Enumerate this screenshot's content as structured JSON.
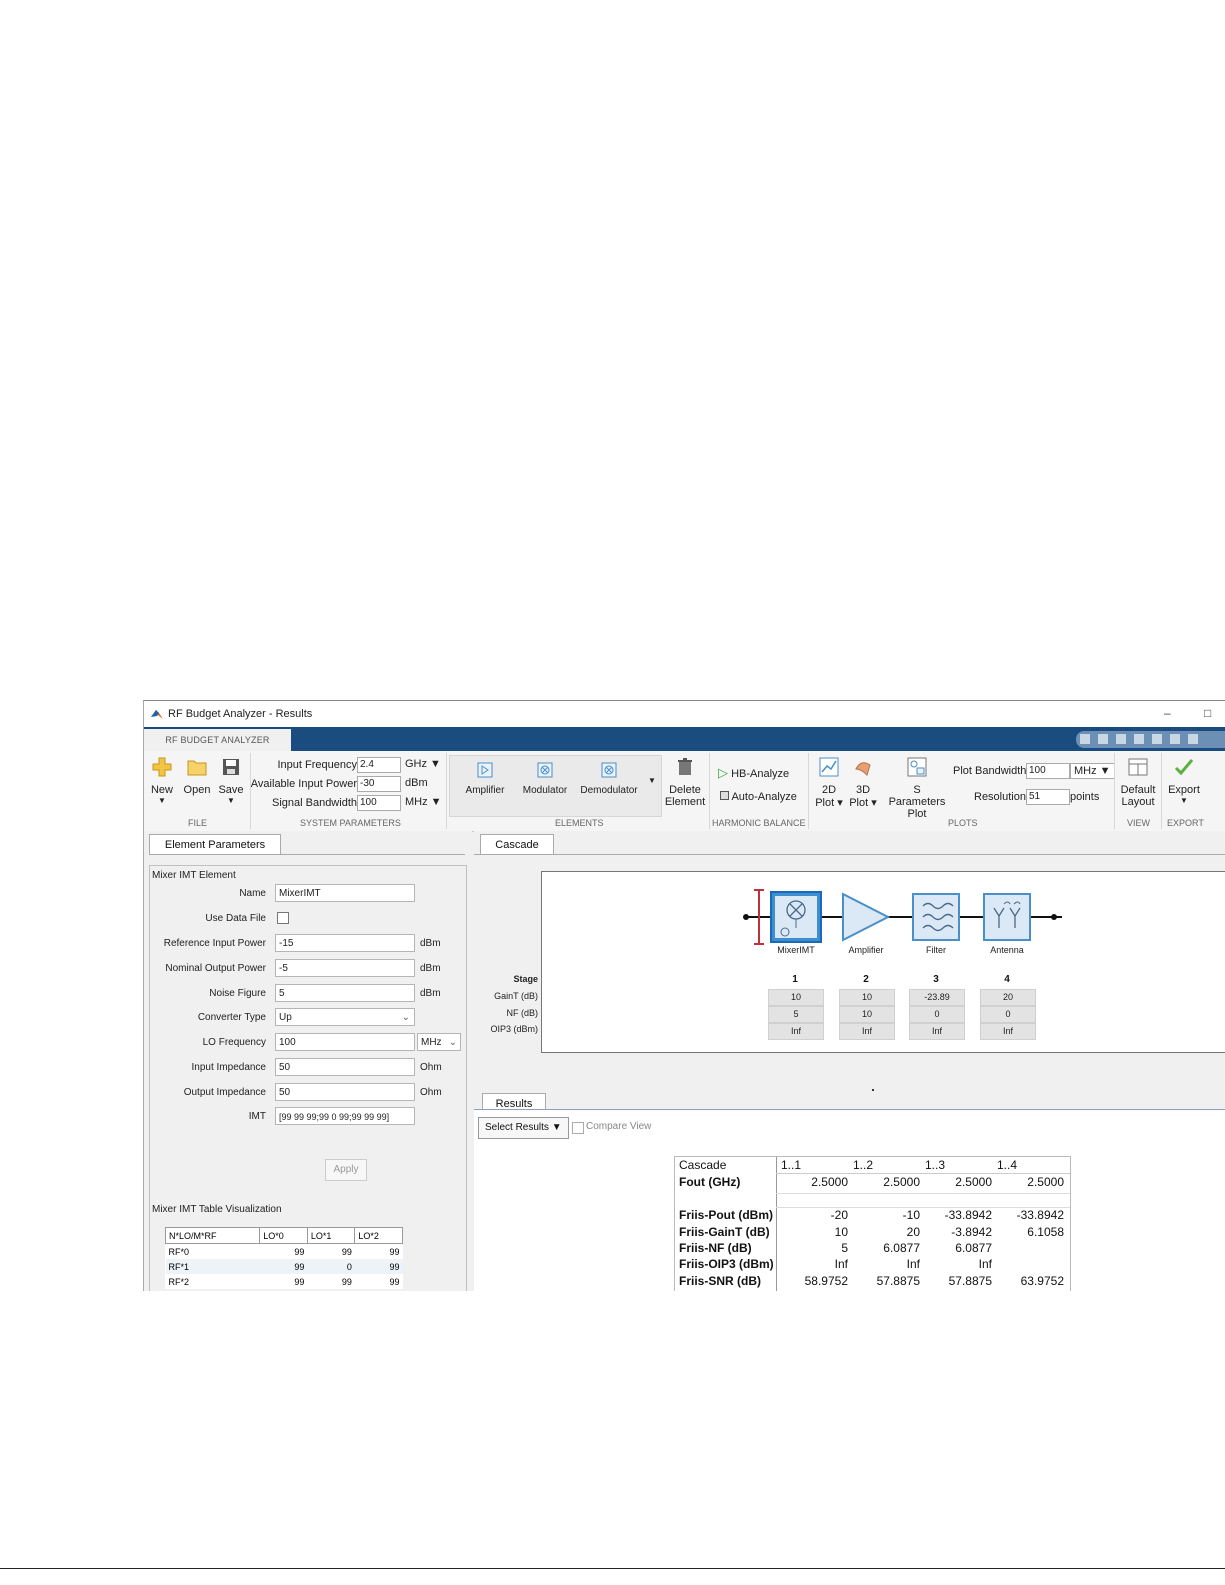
{
  "window": {
    "title": "RF Budget Analyzer - Results",
    "minimize": "–",
    "maximize": "□"
  },
  "ribbon": {
    "tab": "RF BUDGET ANALYZER",
    "file": {
      "new": "New",
      "open": "Open",
      "save": "Save",
      "group": "FILE"
    },
    "system_parameters": {
      "input_frequency_label": "Input Frequency",
      "input_frequency_value": "2.4",
      "input_frequency_unit": "GHz",
      "available_input_power_label": "Available Input Power",
      "available_input_power_value": "-30",
      "available_input_power_unit": "dBm",
      "signal_bandwidth_label": "Signal Bandwidth",
      "signal_bandwidth_value": "100",
      "signal_bandwidth_unit": "MHz",
      "group": "SYSTEM PARAMETERS"
    },
    "elements": {
      "amplifier": "Amplifier",
      "modulator": "Modulator",
      "demodulator": "Demodulator",
      "delete_element_line1": "Delete",
      "delete_element_line2": "Element",
      "group": "ELEMENTS"
    },
    "harmonic_balance": {
      "hb_analyze": "HB-Analyze",
      "auto_analyze": "Auto-Analyze",
      "group": "HARMONIC BALANCE"
    },
    "plots": {
      "plot_2d_line1": "2D",
      "plot_2d_line2": "Plot ▾",
      "plot_3d_line1": "3D",
      "plot_3d_line2": "Plot ▾",
      "sparams_line1": "S Parameters",
      "sparams_line2": "Plot",
      "plot_bandwidth_label": "Plot Bandwidth",
      "plot_bandwidth_value": "100",
      "plot_bandwidth_unit": "MHz",
      "resolution_label": "Resolution",
      "resolution_value": "51",
      "resolution_unit": "points",
      "group": "PLOTS"
    },
    "view": {
      "default_layout_line1": "Default",
      "default_layout_line2": "Layout",
      "group": "VIEW"
    },
    "export": {
      "export": "Export",
      "group": "EXPORT"
    }
  },
  "element_parameters": {
    "tab": "Element Parameters",
    "section_title": "Mixer IMT Element",
    "fields": {
      "name_label": "Name",
      "name_value": "MixerIMT",
      "use_data_file_label": "Use Data File",
      "ref_input_power_label": "Reference Input Power",
      "ref_input_power_value": "-15",
      "ref_input_power_unit": "dBm",
      "nominal_output_power_label": "Nominal Output Power",
      "nominal_output_power_value": "-5",
      "nominal_output_power_unit": "dBm",
      "noise_figure_label": "Noise Figure",
      "noise_figure_value": "5",
      "noise_figure_unit": "dBm",
      "converter_type_label": "Converter Type",
      "converter_type_value": "Up",
      "lo_frequency_label": "LO Frequency",
      "lo_frequency_value": "100",
      "lo_frequency_unit": "MHz",
      "input_impedance_label": "Input Impedance",
      "input_impedance_value": "50",
      "input_impedance_unit": "Ohm",
      "output_impedance_label": "Output Impedance",
      "output_impedance_value": "50",
      "output_impedance_unit": "Ohm",
      "imt_label": "IMT",
      "imt_value": "[99 99 99;99 0 99;99 99 99]"
    },
    "apply": "Apply",
    "table_title": "Mixer IMT Table Visualization",
    "table": {
      "headers": [
        "N*LO/M*RF",
        "LO*0",
        "LO*1",
        "LO*2"
      ],
      "rows": [
        [
          "RF*0",
          "99",
          "99",
          "99"
        ],
        [
          "RF*1",
          "99",
          "0",
          "99"
        ],
        [
          "RF*2",
          "99",
          "99",
          "99"
        ]
      ]
    }
  },
  "cascade": {
    "tab": "Cascade",
    "elements": [
      "MixerIMT",
      "Amplifier",
      "Filter",
      "Antenna"
    ],
    "row_labels": {
      "stage": "Stage",
      "gain": "GainT (dB)",
      "nf": "NF (dB)",
      "oip3": "OIP3 (dBm)"
    },
    "stages": [
      "1",
      "2",
      "3",
      "4"
    ],
    "gain": [
      "10",
      "10",
      "-23.89",
      "20"
    ],
    "nf": [
      "5",
      "10",
      "0",
      "0"
    ],
    "oip3": [
      "Inf",
      "Inf",
      "Inf",
      "Inf"
    ]
  },
  "results": {
    "tab": "Results",
    "select_results": "Select Results ▼",
    "compare_view": "Compare View",
    "header_label": "Cascade",
    "columns": [
      "1..1",
      "1..2",
      "1..3",
      "1..4"
    ],
    "fout_label": "Fout (GHz)",
    "fout": [
      "2.5000",
      "2.5000",
      "2.5000",
      "2.5000"
    ],
    "rows": [
      {
        "label": "Friis-Pout (dBm)",
        "values": [
          "-20",
          "-10",
          "-33.8942",
          "-33.8942"
        ]
      },
      {
        "label": "Friis-GainT (dB)",
        "values": [
          "10",
          "20",
          "-3.8942",
          "6.1058"
        ]
      },
      {
        "label": "Friis-NF (dB)",
        "values": [
          "5",
          "6.0877",
          "6.0877",
          ""
        ]
      },
      {
        "label": "Friis-OIP3 (dBm)",
        "values": [
          "Inf",
          "Inf",
          "Inf",
          ""
        ]
      },
      {
        "label": "Friis-SNR (dB)",
        "values": [
          "58.9752",
          "57.8875",
          "57.8875",
          "63.9752"
        ]
      }
    ]
  },
  "colors": {
    "ribbon_blue": "#1a4c80",
    "element_blue": "#4a8fc8",
    "hb_green": "#3aa84a",
    "export_check": "#5ab040"
  }
}
